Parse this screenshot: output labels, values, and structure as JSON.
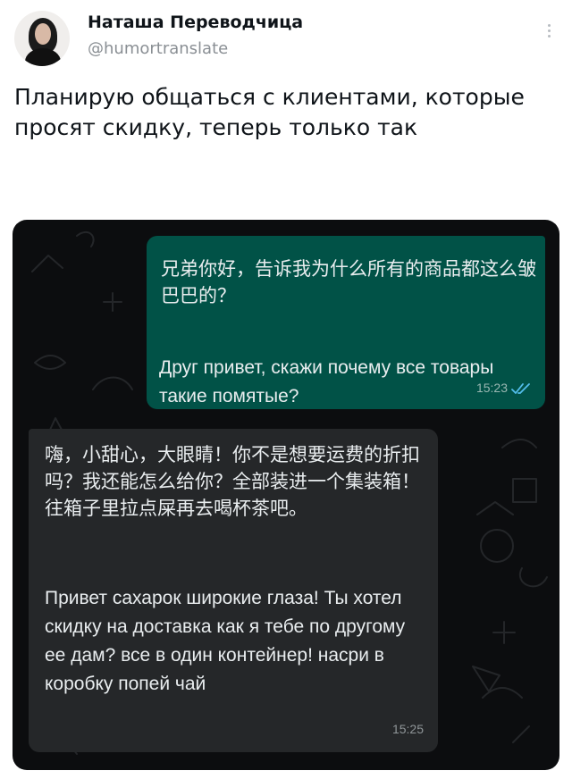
{
  "tweet": {
    "display_name": "Наташа Переводчица",
    "handle": "@humortranslate",
    "text": "Планирую общаться с клиентами, которые просят скидку, теперь только так"
  },
  "chat": {
    "outgoing": {
      "chinese": "兄弟你好，告诉我为什么所有的商品都这么皱巴巴的？",
      "russian": "Друг привет, скажи почему все товары такие помятые?",
      "time": "15:23",
      "status_icon": "double-check-read-icon",
      "bubble_color": "#015247"
    },
    "incoming": {
      "chinese": "嗨，小甜心，大眼睛！你不是想要运费的折扣吗？我还能怎么给你？全部装进一个集装箱！往箱子里拉点屎再去喝杯茶吧。",
      "russian": "Привет сахарок широкие глаза! Ты хотел скидку на доставка как я тебе по другому ее дам? все в один контейнер! насри в коробку попей чай",
      "time": "15:25",
      "bubble_color": "#252729"
    }
  },
  "colors": {
    "accent_tick": "#53bdeb",
    "chat_background": "#0c0d0f"
  }
}
